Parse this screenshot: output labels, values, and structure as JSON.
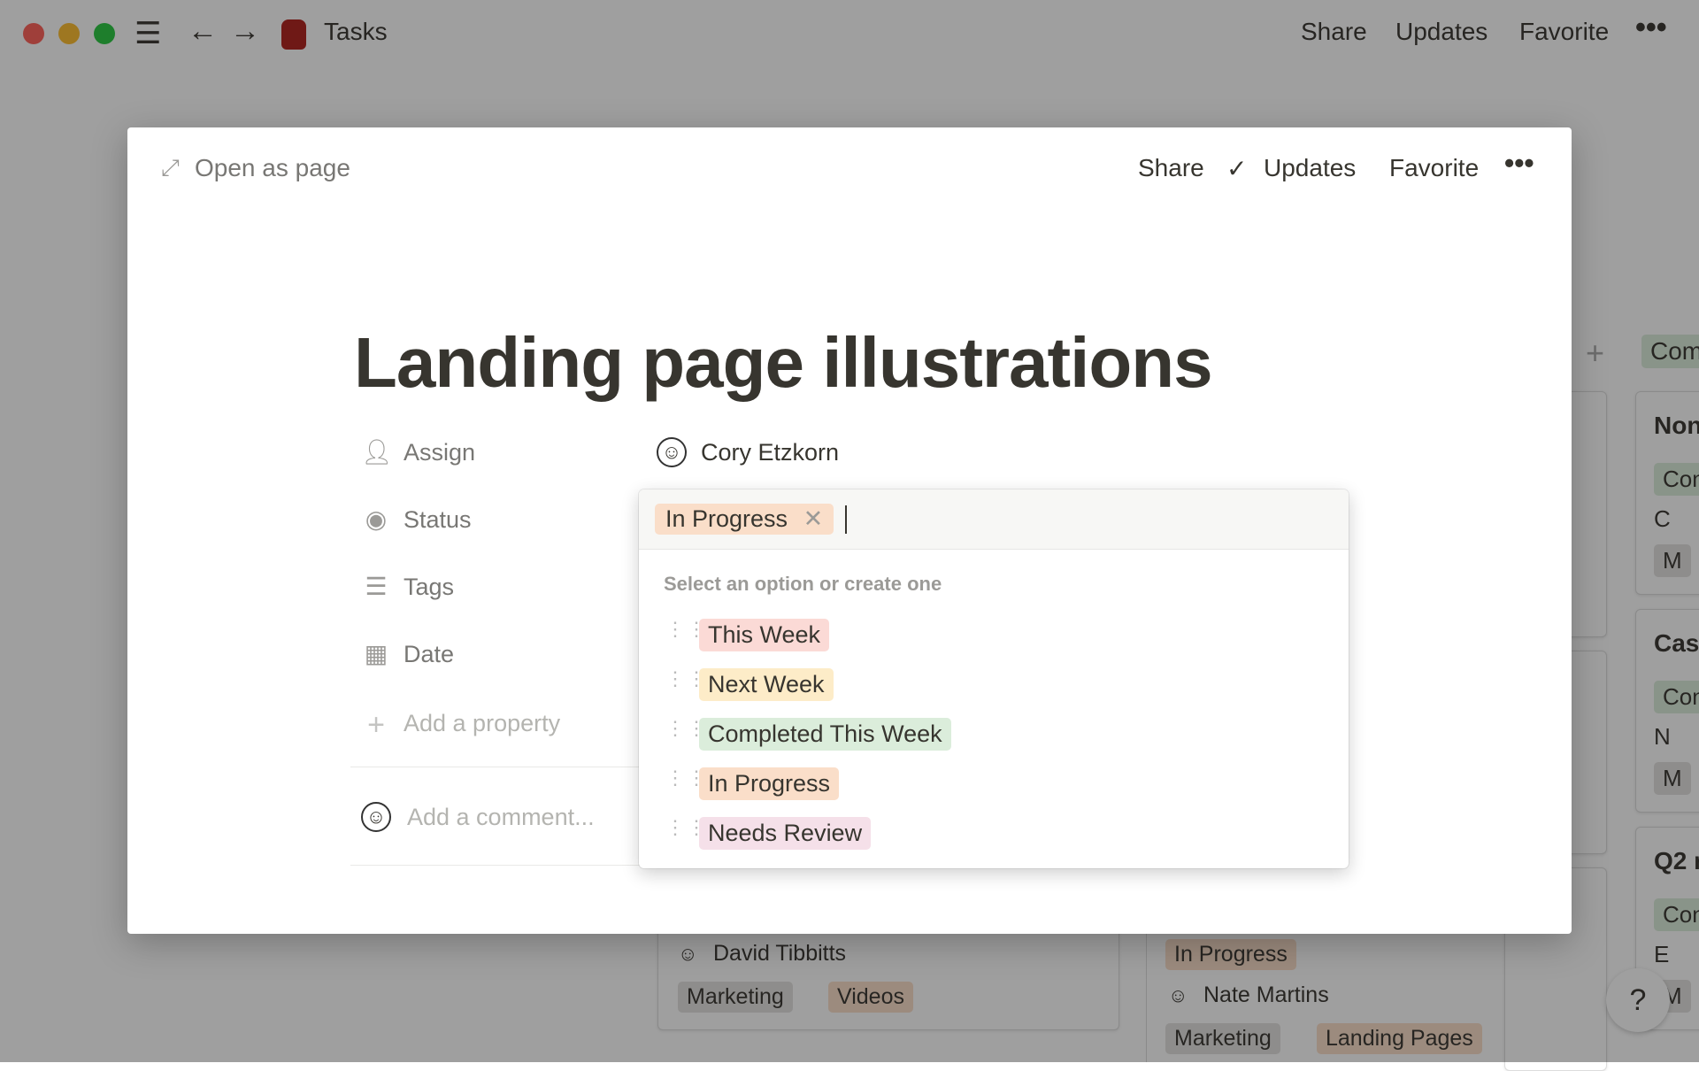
{
  "window": {
    "title": "Tasks",
    "actions": [
      "Share",
      "Updates",
      "Favorite"
    ]
  },
  "background": {
    "column_chip": "Com",
    "right_cards": [
      {
        "title": "Non",
        "status": "Con",
        "person": "C",
        "tag": "M"
      },
      {
        "title": "Cas",
        "status": "Con",
        "person": "N",
        "tag": "M"
      },
      {
        "title": "Q2 r",
        "status": "Con",
        "person": "E",
        "tag": "M"
      }
    ],
    "card_a": {
      "person": "David Tibbitts",
      "tags": [
        "Marketing",
        "Videos"
      ]
    },
    "card_b": {
      "status": "In Progress",
      "person": "Nate Martins",
      "tags": [
        "Marketing",
        "Landing Pages"
      ]
    },
    "help": "?"
  },
  "modal": {
    "open_as_page": "Open as page",
    "share": "Share",
    "updates": "Updates",
    "favorite": "Favorite",
    "title": "Landing page illustrations",
    "properties": [
      {
        "label": "Assign",
        "icon": "person-icon"
      },
      {
        "label": "Status",
        "icon": "chevron-circle-icon"
      },
      {
        "label": "Tags",
        "icon": "list-icon"
      },
      {
        "label": "Date",
        "icon": "calendar-icon"
      }
    ],
    "assignee": "Cory Etzkorn",
    "add_property": "Add a property",
    "comment_placeholder": "Add a comment..."
  },
  "status_dropdown": {
    "selected": "In Progress",
    "hint": "Select an option or create one",
    "options": [
      {
        "label": "This Week",
        "color": "#fbdad6"
      },
      {
        "label": "Next Week",
        "color": "#fdecc8"
      },
      {
        "label": "Completed This Week",
        "color": "#dbeddb"
      },
      {
        "label": "In Progress",
        "color": "#fadec9"
      },
      {
        "label": "Needs Review",
        "color": "#f5e0e9"
      }
    ]
  }
}
